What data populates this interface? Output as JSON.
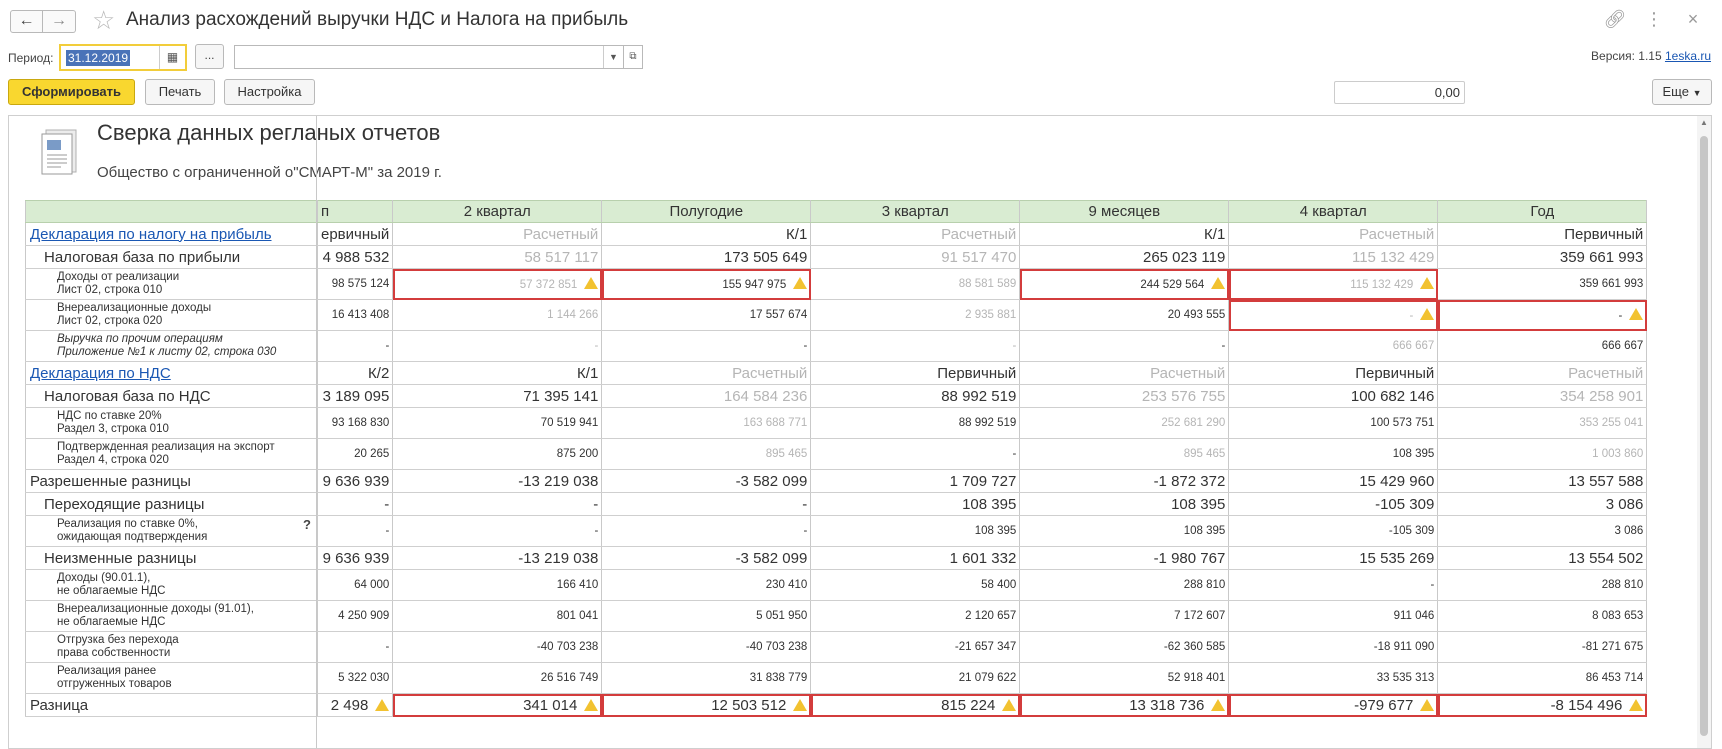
{
  "window": {
    "title": "Анализ расхождений выручки НДС и Налога на прибыль"
  },
  "filters": {
    "period_label": "Период:",
    "period_value": "31.12.2019",
    "dots": "...",
    "org_value": ""
  },
  "version": {
    "text": "Версия: 1.15",
    "link": "1eska.ru"
  },
  "toolbar": {
    "generate": "Сформировать",
    "print": "Печать",
    "settings": "Настройка",
    "sum_value": "0,00",
    "more": "Еще"
  },
  "report": {
    "title": "Сверка данных регланых отчетов",
    "org_line": "Общество с ограниченной о\"СМАРТ-М\" за 2019 г.",
    "columns": [
      "п",
      "2 квартал",
      "Полугодие",
      "3 квартал",
      "9 месяцев",
      "4 квартал",
      "Год"
    ],
    "rows": [
      {
        "type": "section",
        "label": "Декларация по налогу на прибыль",
        "cells": [
          "ервичный",
          "Расчетный",
          "К/1",
          "Расчетный",
          "К/1",
          "Расчетный",
          "Первичный"
        ],
        "muted": [
          false,
          true,
          false,
          true,
          false,
          true,
          false
        ]
      },
      {
        "type": "big",
        "indent": 1,
        "label": "Налоговая база по прибыли",
        "cells": [
          "4 988 532",
          "58 517 117",
          "173 505 649",
          "91 517 470",
          "265 023 119",
          "115 132 429",
          "359 661 993"
        ],
        "muted": [
          false,
          true,
          false,
          true,
          false,
          true,
          false
        ]
      },
      {
        "type": "small",
        "indent": 2,
        "label": "Доходы от реализации",
        "label2": "Лист 02, строка 010",
        "cells": [
          "98 575 124",
          "57 372 851",
          "155 947 975",
          "88 581 589",
          "244 529 564",
          "115 132 429",
          "359 661 993"
        ],
        "muted": [
          false,
          true,
          false,
          true,
          false,
          true,
          false
        ],
        "bad": [
          false,
          true,
          true,
          false,
          true,
          true,
          false
        ]
      },
      {
        "type": "small",
        "indent": 2,
        "label": "Внереализационные доходы",
        "label2": "Лист 02, строка 020",
        "cells": [
          "16 413 408",
          "1 144 266",
          "17 557 674",
          "2 935 881",
          "20 493 555",
          "-",
          "-"
        ],
        "muted": [
          false,
          true,
          false,
          true,
          false,
          true,
          false
        ],
        "bad": [
          false,
          false,
          false,
          false,
          false,
          true,
          true
        ]
      },
      {
        "type": "small",
        "indent": 2,
        "italic": true,
        "label": "Выручка по прочим операциям",
        "label2": "Приложение №1 к листу 02, строка 030",
        "cells": [
          "-",
          "-",
          "-",
          "-",
          "-",
          "666 667",
          "666 667"
        ],
        "muted": [
          false,
          true,
          false,
          true,
          false,
          true,
          false
        ]
      },
      {
        "type": "section",
        "label": "Декларация по НДС",
        "cells": [
          "К/2",
          "К/1",
          "Расчетный",
          "Первичный",
          "Расчетный",
          "Первичный",
          "Расчетный"
        ],
        "muted": [
          false,
          false,
          true,
          false,
          true,
          false,
          true
        ]
      },
      {
        "type": "big",
        "indent": 1,
        "label": "Налоговая база по НДС",
        "cells": [
          "3 189 095",
          "71 395 141",
          "164 584 236",
          "88 992 519",
          "253 576 755",
          "100 682 146",
          "354 258 901"
        ],
        "muted": [
          false,
          false,
          true,
          false,
          true,
          false,
          true
        ]
      },
      {
        "type": "small",
        "indent": 2,
        "label": "НДС по ставке 20%",
        "label2": "Раздел 3, строка 010",
        "cells": [
          "93 168 830",
          "70 519 941",
          "163 688 771",
          "88 992 519",
          "252 681 290",
          "100 573 751",
          "353 255 041"
        ],
        "muted": [
          false,
          false,
          true,
          false,
          true,
          false,
          true
        ]
      },
      {
        "type": "small",
        "indent": 2,
        "label": "Подтвержденная реализация на экспорт",
        "label2": "Раздел 4, строка 020",
        "cells": [
          "20 265",
          "875 200",
          "895 465",
          "-",
          "895 465",
          "108 395",
          "1 003 860"
        ],
        "muted": [
          false,
          false,
          true,
          false,
          true,
          false,
          true
        ]
      },
      {
        "type": "big",
        "indent": 0,
        "label": "Разрешенные разницы",
        "cells": [
          "9 636 939",
          "-13 219 038",
          "-3 582 099",
          "1 709 727",
          "-1 872 372",
          "15 429 960",
          "13 557 588"
        ]
      },
      {
        "type": "big",
        "indent": 1,
        "label": "Переходящие разницы",
        "cells": [
          "-",
          "-",
          "-",
          "108 395",
          "108 395",
          "-105 309",
          "3 086"
        ]
      },
      {
        "type": "small",
        "indent": 2,
        "label": "Реализация по ставке 0%,",
        "label2": "ожидающая подтверждения",
        "question": "?",
        "cells": [
          "-",
          "-",
          "-",
          "108 395",
          "108 395",
          "-105 309",
          "3 086"
        ]
      },
      {
        "type": "big",
        "indent": 1,
        "label": "Неизменные разницы",
        "cells": [
          "9 636 939",
          "-13 219 038",
          "-3 582 099",
          "1 601 332",
          "-1 980 767",
          "15 535 269",
          "13 554 502"
        ]
      },
      {
        "type": "small",
        "indent": 2,
        "label": "Доходы (90.01.1),",
        "label2": "не облагаемые НДС",
        "cells": [
          "64 000",
          "166 410",
          "230 410",
          "58 400",
          "288 810",
          "-",
          "288 810"
        ]
      },
      {
        "type": "small",
        "indent": 2,
        "label": "Внереализационные доходы (91.01),",
        "label2": "не облагаемые НДС",
        "cells": [
          "4 250 909",
          "801 041",
          "5 051 950",
          "2 120 657",
          "7 172 607",
          "911 046",
          "8 083 653"
        ]
      },
      {
        "type": "small",
        "indent": 2,
        "label": "Отгрузка без перехода",
        "label2": "права собственности",
        "cells": [
          "-",
          "-40 703 238",
          "-40 703 238",
          "-21 657 347",
          "-62 360 585",
          "-18 911 090",
          "-81 271 675"
        ]
      },
      {
        "type": "small",
        "indent": 2,
        "label": "Реализация ранее",
        "label2": "отгруженных товаров",
        "cells": [
          "5 322 030",
          "26 516 749",
          "31 838 779",
          "21 079 622",
          "52 918 401",
          "33 535 313",
          "86 453 714"
        ]
      },
      {
        "type": "big",
        "indent": 0,
        "label": "Разница",
        "cells": [
          "2 498",
          "341 014",
          "12 503 512",
          "815 224",
          "13 318 736",
          "-979 677",
          "-8 154 496"
        ],
        "bad": [
          false,
          true,
          true,
          true,
          true,
          true,
          true
        ],
        "warn": [
          true,
          true,
          true,
          true,
          true,
          true,
          true
        ]
      }
    ],
    "warn_small": [
      [
        false,
        true,
        true,
        false,
        true,
        true,
        false
      ],
      [
        false,
        false,
        false,
        false,
        false,
        true,
        true
      ]
    ]
  },
  "colors": {
    "header_bg": "#d9ecd2",
    "accent": "#f9d72f",
    "error": "#d33c3c",
    "link": "#1a57b3"
  }
}
